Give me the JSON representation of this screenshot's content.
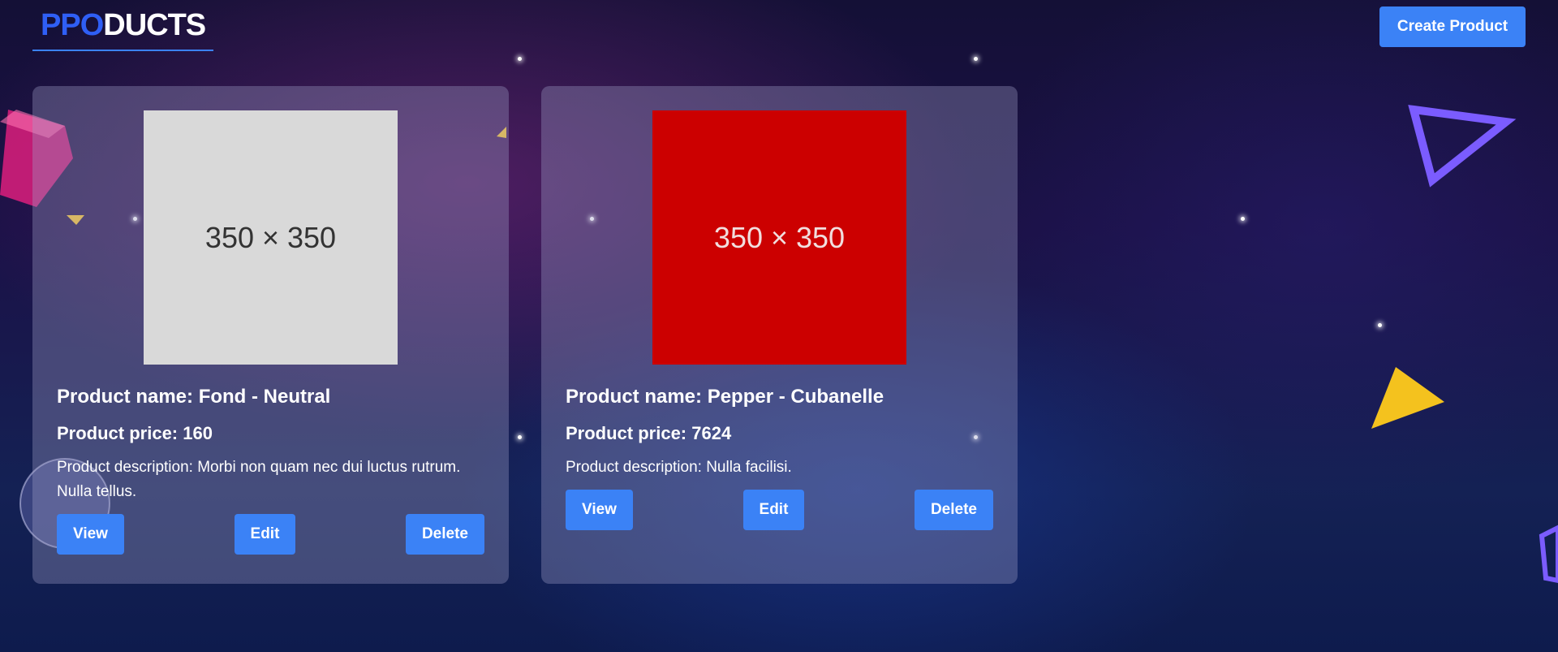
{
  "header": {
    "logo_accent": "PPO",
    "logo_rest": "DUCTS",
    "create_label": "Create Product"
  },
  "products": [
    {
      "image_label": "350 × 350",
      "name": "Product name: Fond - Neutral",
      "price": "Product price: 160",
      "description": "Product description: Morbi non quam nec dui luctus rutrum. Nulla tellus.",
      "view_label": "View",
      "edit_label": "Edit",
      "delete_label": "Delete"
    },
    {
      "image_label": "350 × 350",
      "name": "Product name: Pepper - Cubanelle",
      "price": "Product price: 7624",
      "description": "Product description: Nulla facilisi.",
      "view_label": "View",
      "edit_label": "Edit",
      "delete_label": "Delete"
    }
  ],
  "colors": {
    "accent": "#3b82f6",
    "logo_accent": "#2f5ff5",
    "image_1": "#d9d9d9",
    "image_2": "#cc0000"
  }
}
